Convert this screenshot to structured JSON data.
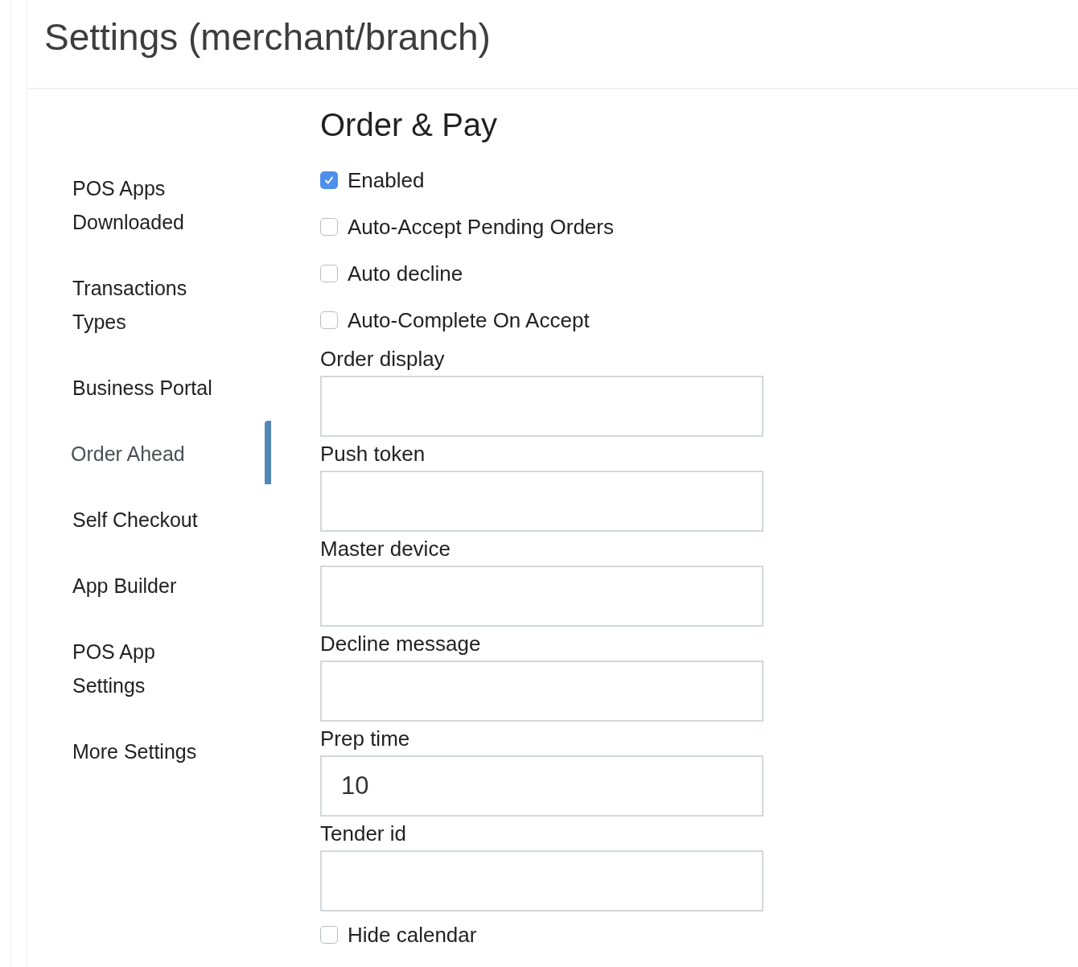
{
  "page_title": "Settings (merchant/branch)",
  "sidebar": {
    "items": [
      {
        "label": "POS Apps Downloaded",
        "selected": false
      },
      {
        "label": "Transactions Types",
        "selected": false
      },
      {
        "label": "Business Portal",
        "selected": false
      },
      {
        "label": "Order Ahead",
        "selected": true
      },
      {
        "label": "Self Checkout",
        "selected": false
      },
      {
        "label": "App Builder",
        "selected": false
      },
      {
        "label": "POS App Settings",
        "selected": false
      },
      {
        "label": "More Settings",
        "selected": false
      }
    ]
  },
  "section": {
    "title": "Order & Pay",
    "items": [
      {
        "kind": "checkbox",
        "label": "Enabled",
        "checked": true
      },
      {
        "kind": "checkbox",
        "label": "Auto-Accept Pending Orders",
        "checked": false
      },
      {
        "kind": "checkbox",
        "label": "Auto decline",
        "checked": false
      },
      {
        "kind": "checkbox",
        "label": "Auto-Complete On Accept",
        "checked": false
      },
      {
        "kind": "field",
        "label": "Order display"
      },
      {
        "kind": "field",
        "label": "Push token"
      },
      {
        "kind": "field",
        "label": "Master device"
      },
      {
        "kind": "field",
        "label": "Decline message"
      },
      {
        "kind": "field",
        "label": "Prep time",
        "value": "10"
      },
      {
        "kind": "field",
        "label": "Tender id"
      },
      {
        "kind": "checkbox",
        "label": "Hide calendar",
        "checked": false
      }
    ]
  }
}
